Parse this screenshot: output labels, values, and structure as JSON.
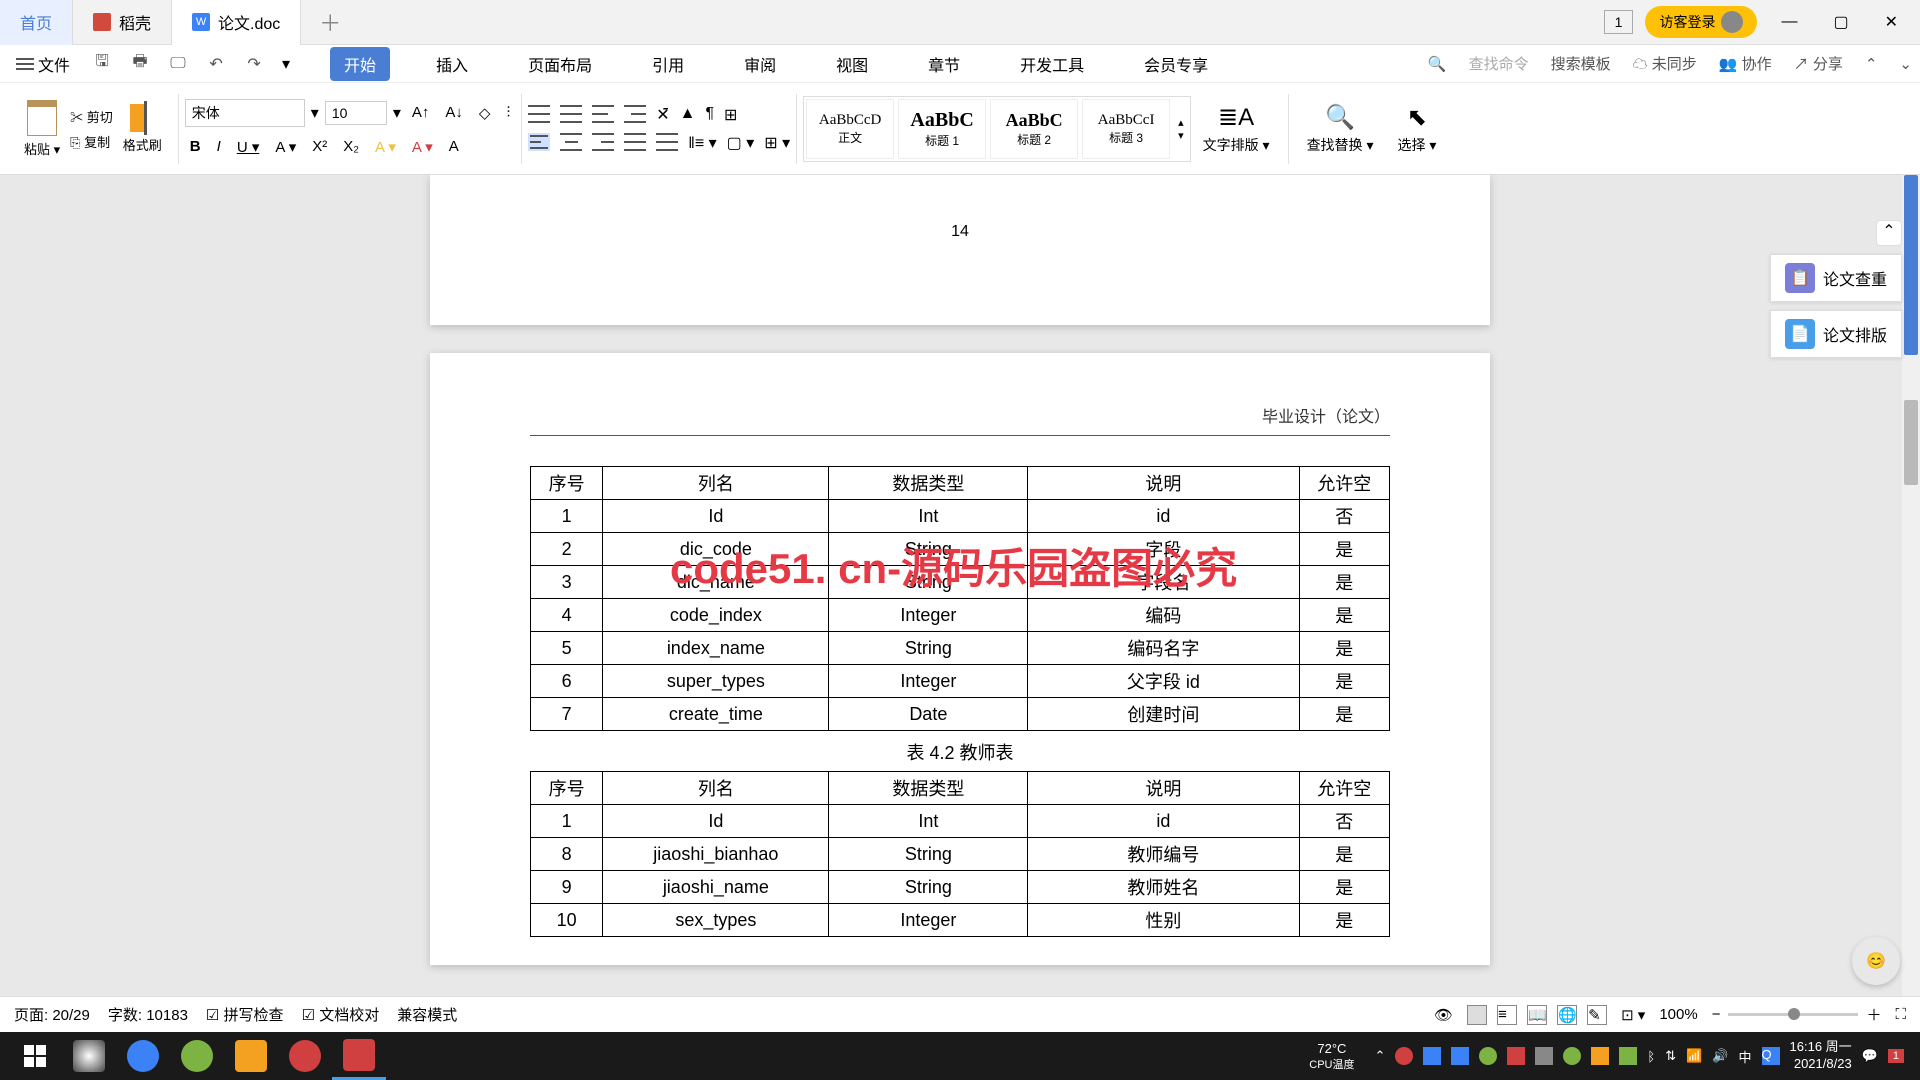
{
  "titlebar": {
    "tabs": [
      {
        "label": "首页",
        "type": "home"
      },
      {
        "label": "稻壳",
        "icon": "red"
      },
      {
        "label": "论文.doc",
        "icon": "blue",
        "iconText": "W",
        "active": true
      }
    ],
    "oneBadge": "1",
    "loginLabel": "访客登录"
  },
  "menubar": {
    "fileLabel": "文件",
    "dropdown": "▾",
    "tabs": [
      "开始",
      "插入",
      "页面布局",
      "引用",
      "审阅",
      "视图",
      "章节",
      "开发工具",
      "会员专享"
    ],
    "activeTab": 0,
    "searchPlaceholder": "查找命令",
    "searchTemplate": "搜索模板",
    "unsyncLabel": "未同步",
    "collabLabel": "协作",
    "shareLabel": "分享"
  },
  "ribbon": {
    "pasteLabel": "粘贴 ▾",
    "brushLabel": "格式刷",
    "cutLabel": "剪切",
    "copyLabel": "复制",
    "fontName": "宋体",
    "fontSize": "10",
    "styles": [
      {
        "preview": "AaBbCcD",
        "label": "正文"
      },
      {
        "preview": "AaBbC",
        "label": "标题 1"
      },
      {
        "preview": "AaBbC",
        "label": "标题 2"
      },
      {
        "preview": "AaBbCcI",
        "label": "标题 3"
      }
    ],
    "textLayout": "文字排版 ▾",
    "findReplace": "查找替换 ▾",
    "select": "选择 ▾"
  },
  "document": {
    "pageNum": "14",
    "headerRight": "毕业设计（论文）",
    "watermarkText": "code51.cn",
    "redWatermark": "code51. cn-源码乐园盗图必究",
    "table1": {
      "headers": [
        "序号",
        "列名",
        "数据类型",
        "说明",
        "允许空"
      ],
      "rows": [
        [
          "1",
          "Id",
          "Int",
          "id",
          "否"
        ],
        [
          "2",
          "dic_code",
          "String",
          "字段",
          "是"
        ],
        [
          "3",
          "dic_name",
          "String",
          "字段名",
          "是"
        ],
        [
          "4",
          "code_index",
          "Integer",
          "编码",
          "是"
        ],
        [
          "5",
          "index_name",
          "String",
          "编码名字",
          "是"
        ],
        [
          "6",
          "super_types",
          "Integer",
          "父字段 id",
          "是"
        ],
        [
          "7",
          "create_time",
          "Date",
          "创建时间",
          "是"
        ]
      ]
    },
    "table2Caption": "表 4.2 教师表",
    "table2": {
      "headers": [
        "序号",
        "列名",
        "数据类型",
        "说明",
        "允许空"
      ],
      "rows": [
        [
          "1",
          "Id",
          "Int",
          "id",
          "否"
        ],
        [
          "8",
          "jiaoshi_bianhao",
          "String",
          "教师编号",
          "是"
        ],
        [
          "9",
          "jiaoshi_name",
          "String",
          "教师姓名",
          "是"
        ],
        [
          "10",
          "sex_types",
          "Integer",
          "性别",
          "是"
        ]
      ]
    }
  },
  "sidePanel": {
    "check": "论文查重",
    "layout": "论文排版"
  },
  "statusbar": {
    "pageLabel": "页面: 20/29",
    "wordLabel": "字数: 10183",
    "spellCheck": "拼写检查",
    "docCheck": "文档校对",
    "compat": "兼容模式",
    "zoom": "100%"
  },
  "taskbar": {
    "cpu": "72°C",
    "cpuLabel": "CPU温度",
    "time": "16:16 周一",
    "date": "2021/8/23",
    "notif": "1"
  }
}
